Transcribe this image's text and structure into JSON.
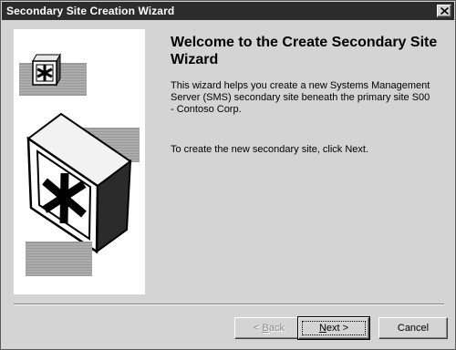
{
  "window": {
    "title": "Secondary Site Creation Wizard"
  },
  "content": {
    "heading": "Welcome to the Create Secondary Site Wizard",
    "intro": "This wizard helps you create a new Systems Management Server (SMS) secondary site beneath the primary site S00 - Contoso Corp.",
    "next_hint": "To create the new secondary site, click Next."
  },
  "buttons": {
    "back": {
      "prefix": "< ",
      "mnemonic": "B",
      "rest": "ack",
      "enabled": false
    },
    "next": {
      "mnemonic": "N",
      "rest": "ext >",
      "enabled": true
    },
    "cancel": {
      "label": "Cancel",
      "enabled": true
    }
  },
  "icons": {
    "close": "close-icon",
    "small_box": "sms-box-small-icon",
    "large_box": "sms-box-large-icon"
  }
}
